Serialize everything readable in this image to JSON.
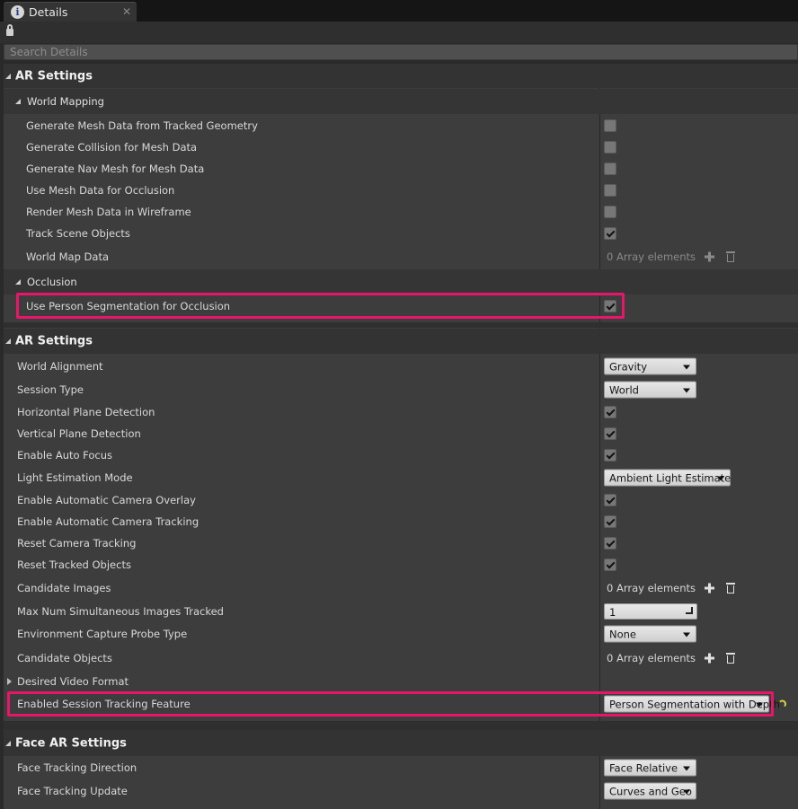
{
  "window": {
    "tab_title": "Details",
    "tab_icon": "info-icon",
    "close_glyph": "✕",
    "info_glyph": "i"
  },
  "toolbar": {
    "lock_icon": "lock-icon"
  },
  "search": {
    "placeholder": "Search Details",
    "value": ""
  },
  "sections": {
    "ar_settings_1": {
      "title": "AR Settings",
      "world_mapping": {
        "title": "World Mapping",
        "props": {
          "gen_mesh": {
            "label": "Generate Mesh Data from Tracked Geometry",
            "checked": false
          },
          "gen_collision": {
            "label": "Generate Collision for Mesh Data",
            "checked": false
          },
          "gen_navmesh": {
            "label": "Generate Nav Mesh for Mesh Data",
            "checked": false
          },
          "mesh_occlusion": {
            "label": "Use Mesh Data for Occlusion",
            "checked": false
          },
          "wireframe": {
            "label": "Render Mesh Data in Wireframe",
            "checked": false
          },
          "track_scene": {
            "label": "Track Scene Objects",
            "checked": true
          },
          "world_map_data": {
            "label": "World Map Data",
            "value": "0 Array elements"
          }
        }
      },
      "occlusion": {
        "title": "Occlusion",
        "props": {
          "person_seg": {
            "label": "Use Person Segmentation for Occlusion",
            "checked": true
          }
        }
      }
    },
    "ar_settings_2": {
      "title": "AR Settings",
      "props": {
        "world_alignment": {
          "label": "World Alignment",
          "value": "Gravity"
        },
        "session_type": {
          "label": "Session Type",
          "value": "World"
        },
        "horizontal_plane": {
          "label": "Horizontal Plane Detection",
          "checked": true
        },
        "vertical_plane": {
          "label": "Vertical Plane Detection",
          "checked": true
        },
        "auto_focus": {
          "label": "Enable Auto Focus",
          "checked": true
        },
        "light_estimation": {
          "label": "Light Estimation Mode",
          "value": "Ambient Light Estimate"
        },
        "camera_overlay": {
          "label": "Enable Automatic Camera Overlay",
          "checked": true
        },
        "camera_tracking": {
          "label": "Enable Automatic Camera Tracking",
          "checked": true
        },
        "reset_camera": {
          "label": "Reset Camera Tracking",
          "checked": true
        },
        "reset_objects": {
          "label": "Reset Tracked Objects",
          "checked": true
        },
        "candidate_images": {
          "label": "Candidate Images",
          "value": "0 Array elements"
        },
        "max_images": {
          "label": "Max Num Simultaneous Images Tracked",
          "value": "1"
        },
        "env_probe": {
          "label": "Environment Capture Probe Type",
          "value": "None"
        },
        "candidate_objects": {
          "label": "Candidate Objects",
          "value": "0 Array elements"
        },
        "video_format": {
          "label": "Desired Video Format"
        },
        "tracking_feature": {
          "label": "Enabled Session Tracking Feature",
          "value": "Person Segmentation with Depth"
        }
      }
    },
    "face_ar": {
      "title": "Face AR Settings",
      "props": {
        "face_direction": {
          "label": "Face Tracking Direction",
          "value": "Face Relative"
        },
        "face_update": {
          "label": "Face Tracking Update",
          "value": "Curves and Geo"
        }
      }
    }
  },
  "colors": {
    "highlight": "#e8156b",
    "reset_arrow": "#d8d243",
    "panel_bg": "#3d3d3d"
  }
}
